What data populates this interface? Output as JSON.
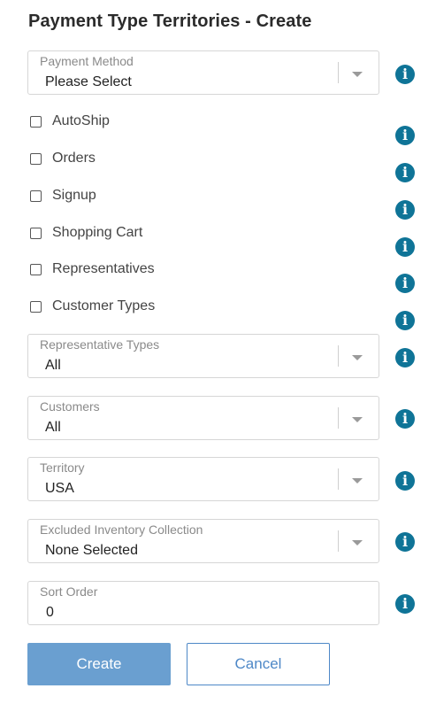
{
  "page": {
    "title": "Payment Type Territories - Create"
  },
  "fields": {
    "payment_method": {
      "label": "Payment Method",
      "value": "Please Select"
    },
    "representative_types": {
      "label": "Representative Types",
      "value": "All"
    },
    "customers": {
      "label": "Customers",
      "value": "All"
    },
    "territory": {
      "label": "Territory",
      "value": "USA"
    },
    "excluded_inventory": {
      "label": "Excluded Inventory Collection",
      "value": "None Selected"
    },
    "sort_order": {
      "label": "Sort Order",
      "value": "0"
    }
  },
  "checkboxes": [
    {
      "label": "AutoShip",
      "checked": false
    },
    {
      "label": "Orders",
      "checked": false
    },
    {
      "label": "Signup",
      "checked": false
    },
    {
      "label": "Shopping Cart",
      "checked": false
    },
    {
      "label": "Representatives",
      "checked": false
    },
    {
      "label": "Customer Types",
      "checked": false
    }
  ],
  "info_icon": {
    "glyph": "i",
    "icon": "info-icon",
    "color": "#0f7497"
  },
  "buttons": {
    "create": "Create",
    "cancel": "Cancel"
  },
  "colors": {
    "primary": "#6a9fd0",
    "cancel_text": "#4e88c7"
  }
}
